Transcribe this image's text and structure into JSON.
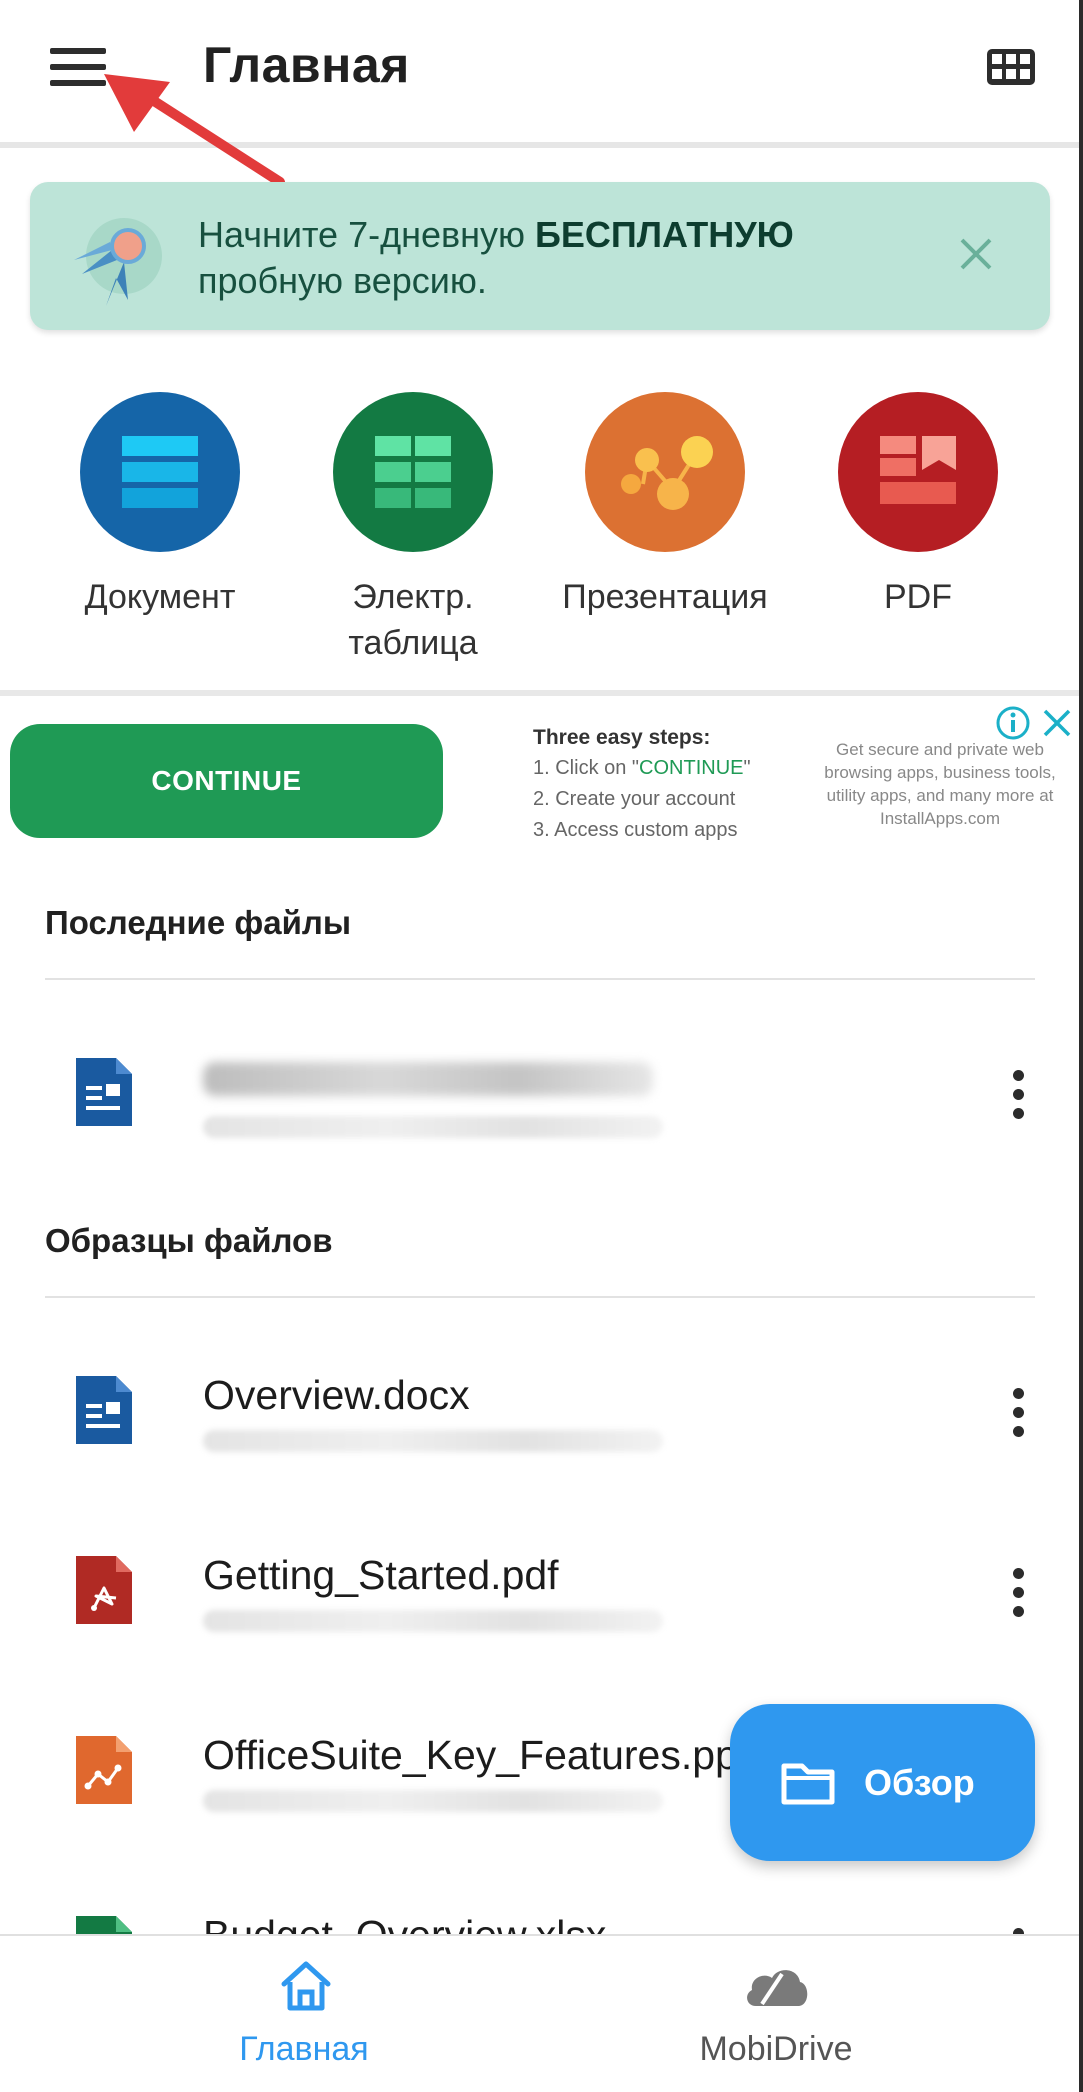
{
  "topbar": {
    "title": "Главная"
  },
  "promo": {
    "text_prefix": "Начните 7-дневную ",
    "text_bold": "БЕСПЛАТНУЮ",
    "text_suffix": "пробную версию."
  },
  "create": [
    {
      "label": "Документ",
      "color": "#1565a8"
    },
    {
      "label": "Электр.\nтаблица",
      "color": "#137a43"
    },
    {
      "label": "Презентация",
      "color": "#dc7132"
    },
    {
      "label": "PDF",
      "color": "#b51e23"
    }
  ],
  "ad": {
    "button_label": "CONTINUE",
    "steps_title": "Three easy steps:",
    "step1_prefix": "1. Click on \"",
    "step1_highlight": "CONTINUE",
    "step1_suffix": "\"",
    "step2": "2. Create your account",
    "step3": "3. Access custom apps",
    "side_text": "Get secure and private web browsing apps, business tools, utility apps, and many more at InstallApps.com"
  },
  "recent": {
    "title": "Последние файлы"
  },
  "samples": {
    "title": "Образцы файлов",
    "files": [
      {
        "name": "Overview.docx",
        "type": "docx"
      },
      {
        "name": "Getting_Started.pdf",
        "type": "pdf"
      },
      {
        "name": "OfficeSuite_Key_Features.pptx",
        "type": "pptx"
      },
      {
        "name": "Budget_Overview.xlsx",
        "type": "xlsx"
      }
    ]
  },
  "fab": {
    "label": "Обзор"
  },
  "bottom_nav": {
    "home_label": "Главная",
    "drive_label": "MobiDrive"
  },
  "colors": {
    "accent": "#2f98ef",
    "promo_bg": "#bde4d8",
    "ad_green": "#1f9a55"
  }
}
